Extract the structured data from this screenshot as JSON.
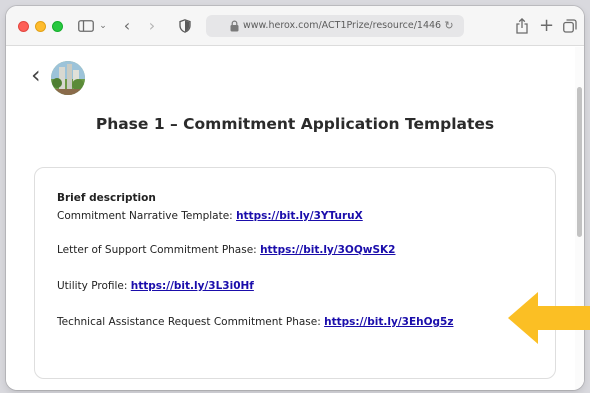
{
  "browser": {
    "url": "www.herox.com/ACT1Prize/resource/1446"
  },
  "page": {
    "title": "Phase 1 – Commitment Application Templates",
    "card": {
      "heading": "Brief description",
      "lines": [
        {
          "label": "Commitment Narrative Template: ",
          "link": "https://bit.ly/3YTuruX"
        },
        {
          "label": "Letter of Support Commitment Phase: ",
          "link": "https://bit.ly/3OQwSK2"
        },
        {
          "label": "Utility Profile: ",
          "link": "https://bit.ly/3L3i0Hf"
        },
        {
          "label": "Technical Assistance Request Commitment Phase: ",
          "link": "https://bit.ly/3EhOg5z"
        }
      ]
    }
  },
  "colors": {
    "link": "#1a0dab",
    "annotation_arrow": "#fbbf24"
  },
  "icons": [
    "sidebar-icon",
    "chevron-down-icon",
    "back-arrow-icon",
    "forward-arrow-icon",
    "shield-icon",
    "lock-icon",
    "reload-icon",
    "share-icon",
    "plus-icon",
    "tabs-icon",
    "chevron-left-icon"
  ]
}
